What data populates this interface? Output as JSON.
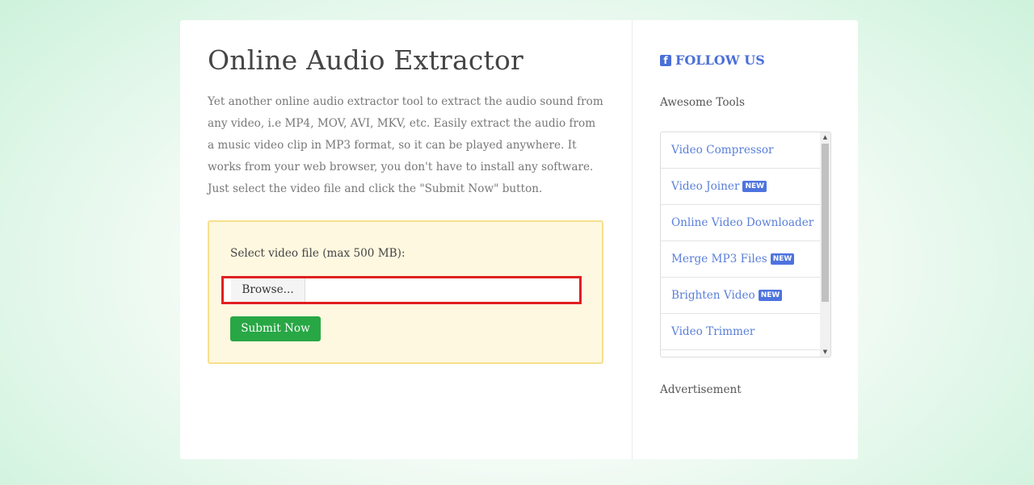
{
  "main": {
    "title": "Online Audio Extractor",
    "description": "Yet another online audio extractor tool to extract the audio sound from any video, i.e MP4, MOV, AVI, MKV, etc. Easily extract the audio from a music video clip in MP3 format, so it can be played anywhere. It works from your web browser, you don't have to install any software. Just select the video file and click the \"Submit Now\" button.",
    "upload": {
      "label": "Select video file (max 500 MB):",
      "browse_label": "Browse...",
      "file_value": "",
      "submit_label": "Submit Now"
    }
  },
  "sidebar": {
    "follow_label": "FOLLOW US",
    "follow_icon": "facebook-icon",
    "tools_heading": "Awesome Tools",
    "tools": [
      {
        "label": "Video Compressor",
        "badge": ""
      },
      {
        "label": "Video Joiner",
        "badge": "NEW"
      },
      {
        "label": "Online Video Downloader",
        "badge": ""
      },
      {
        "label": "Merge MP3 Files",
        "badge": "NEW"
      },
      {
        "label": "Brighten Video",
        "badge": "NEW"
      },
      {
        "label": "Video Trimmer",
        "badge": ""
      }
    ],
    "ad_heading": "Advertisement"
  },
  "colors": {
    "accent": "#4a6fd8",
    "submit": "#28a745",
    "highlight_border": "#e02020",
    "upload_bg": "#fff8e0"
  }
}
